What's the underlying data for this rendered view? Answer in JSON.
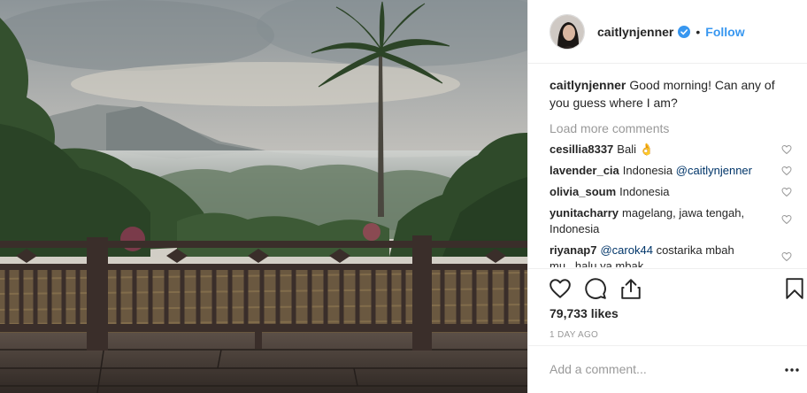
{
  "header": {
    "username": "caitlynjenner",
    "separator": "•",
    "follow_label": "Follow"
  },
  "caption": {
    "username": "caitlynjenner",
    "text": "Good morning! Can any of you guess where I am?"
  },
  "load_more_label": "Load more comments",
  "comments": [
    {
      "username": "cesillia8337",
      "text": "Bali",
      "emoji": "👌"
    },
    {
      "username": "lavender_cia",
      "text": "Indonesia",
      "mention": "@caitlynjenner"
    },
    {
      "username": "olivia_soum",
      "text": "Indonesia"
    },
    {
      "username": "yunitacharry",
      "text": "magelang, jawa tengah, Indonesia"
    },
    {
      "username": "riyanap7",
      "mention": "@carok44",
      "text": "costarika mbah mu...halu ya mbak"
    }
  ],
  "actions": {
    "like_icon": "heart-outline-icon",
    "comment_icon": "comment-icon",
    "share_icon": "share-icon",
    "save_icon": "bookmark-icon"
  },
  "likes_label": "79,733 likes",
  "time_label": "1 DAY AGO",
  "add_comment": {
    "placeholder": "Add a comment..."
  },
  "more_icon": "more-options-icon",
  "colors": {
    "link": "#3897f0",
    "mention": "#003569",
    "muted": "#999999",
    "text": "#262626",
    "border": "#efefef"
  }
}
